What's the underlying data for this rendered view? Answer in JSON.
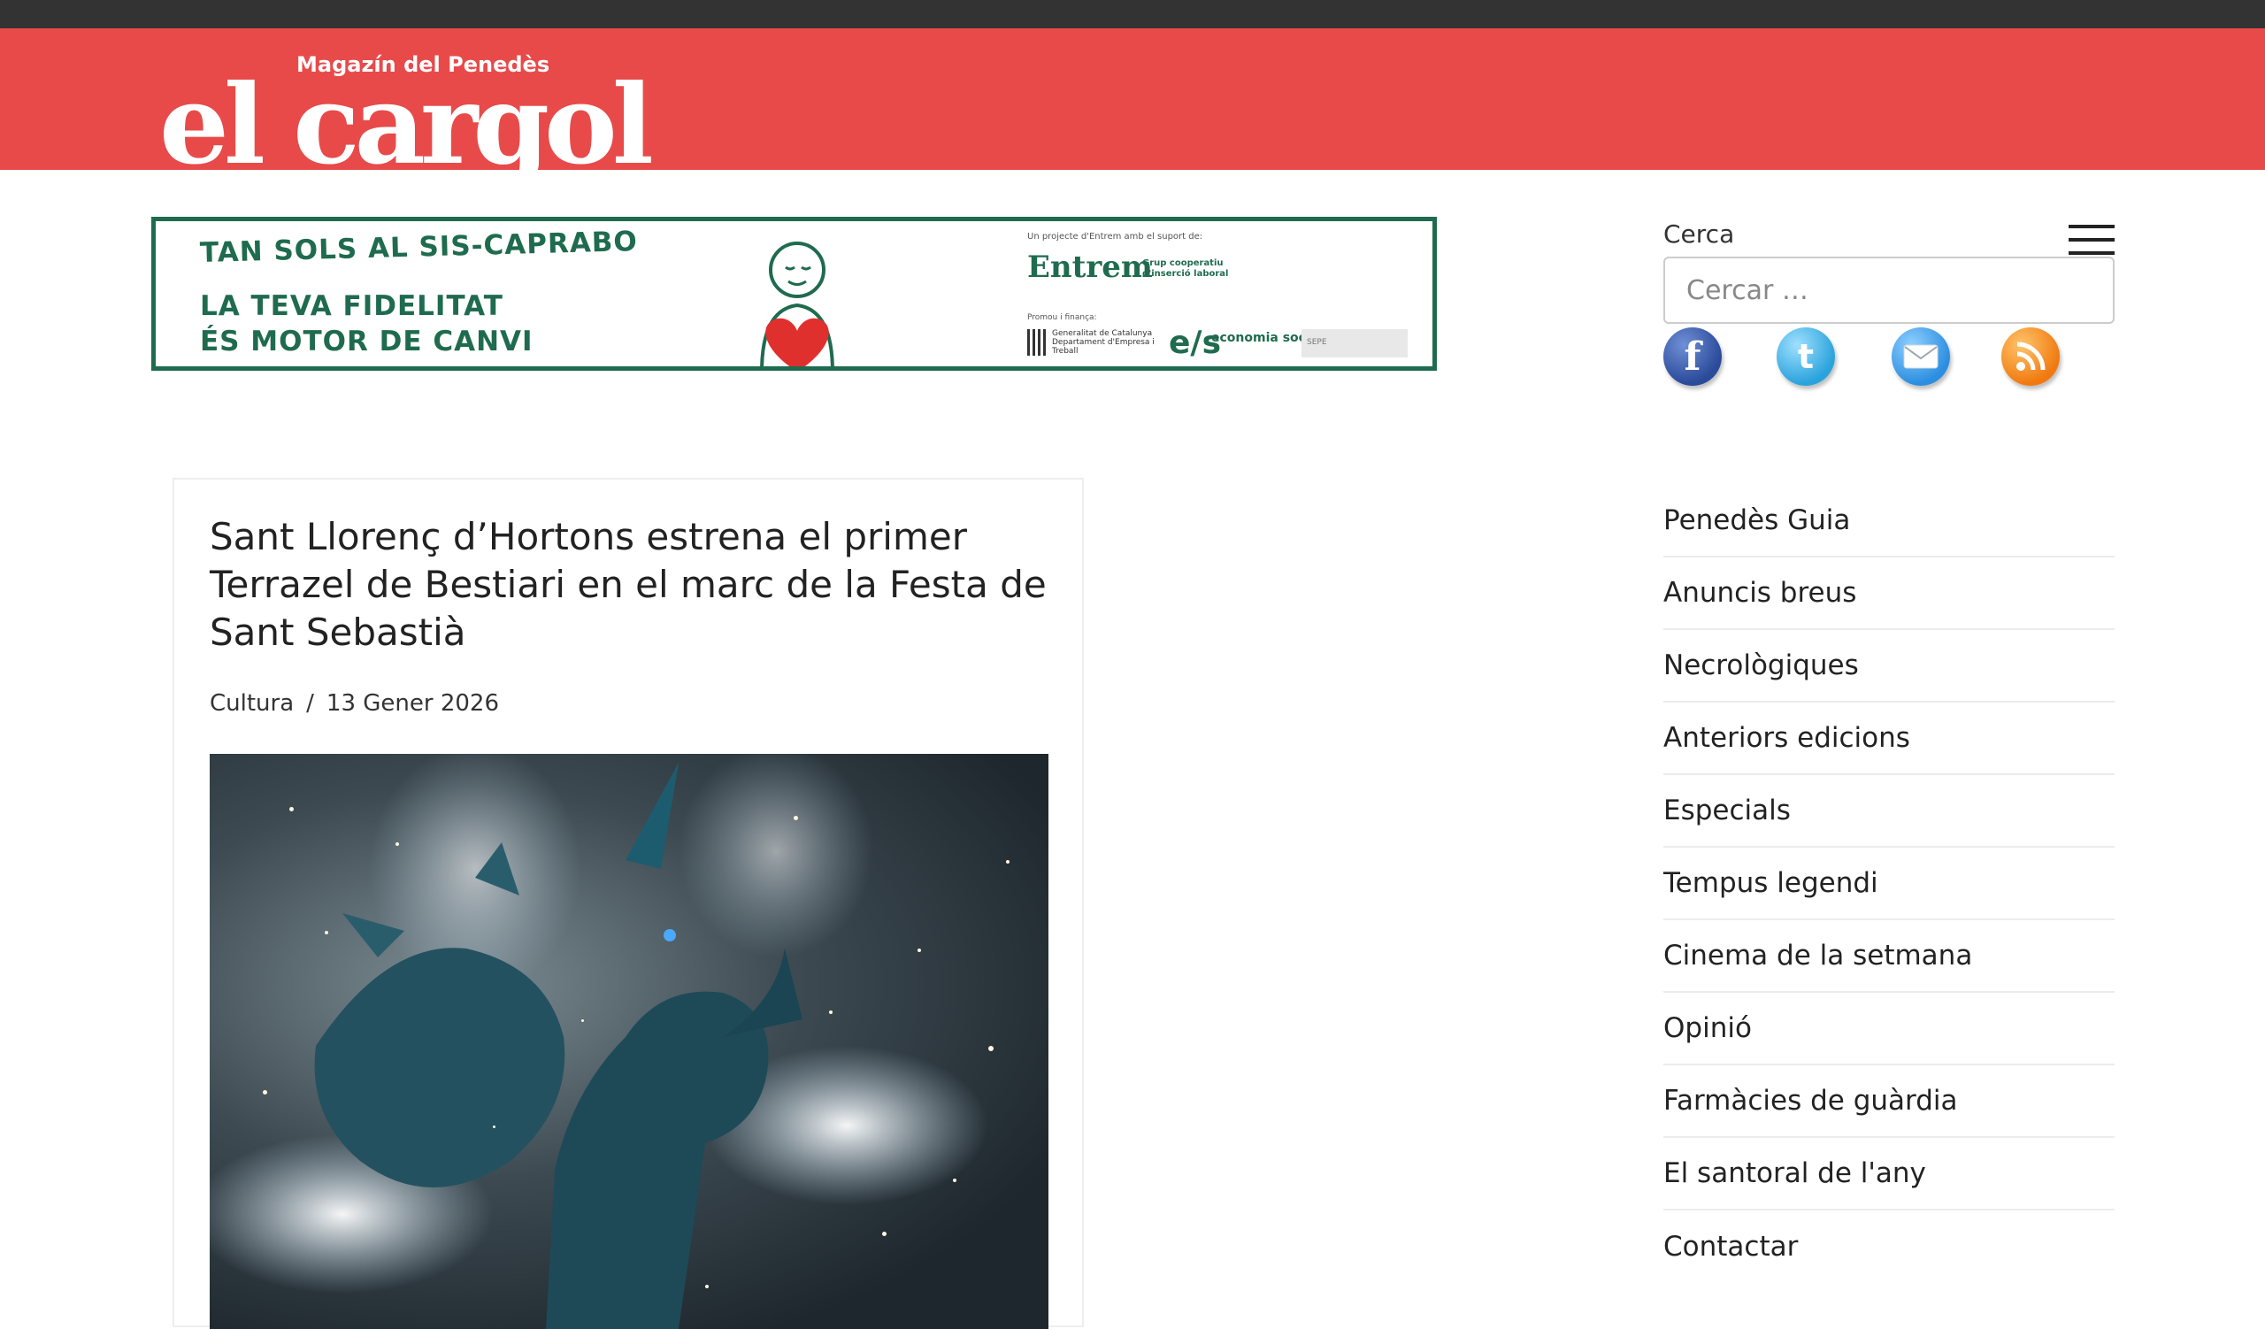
{
  "header": {
    "logo_tagline": "Magazín del Penedès",
    "logo_name": "el cargol",
    "brand_color": "#e84a4a"
  },
  "banner": {
    "line1": "TAN SOLS AL SIS-CAPRABO",
    "line2": "LA TEVA FIDELITAT",
    "line3": "ÉS MOTOR DE CANVI",
    "org_small": "Un projecte d'Entrem amb el suport de:",
    "entrem": "Entrem",
    "entrem_sub": "Grup cooperatiu d'inserció laboral",
    "promou": "Promou i finança:",
    "generalitat": "Generalitat de Catalunya Departament d'Empresa i Treball",
    "es_mark": "e/s",
    "economia": "economia social",
    "sepe": "SEPE",
    "accent_color": "#1f6b4f"
  },
  "sidebar": {
    "search_label": "Cerca",
    "search_placeholder": "Cercar …",
    "social": [
      {
        "name": "facebook-icon",
        "glyph": "f"
      },
      {
        "name": "twitter-icon",
        "glyph": "t"
      },
      {
        "name": "email-icon",
        "glyph": ""
      },
      {
        "name": "rss-icon",
        "glyph": ""
      }
    ],
    "nav_items": [
      "Penedès Guia",
      "Anuncis breus",
      "Necrològiques",
      "Anteriors edicions",
      "Especials",
      "Tempus legendi",
      "Cinema de la setmana",
      "Opinió",
      "Farmàcies de guàrdia",
      "El santoral de l'any",
      "Contactar"
    ]
  },
  "article": {
    "title": "Sant Llorenç d’Hortons estrena el primer Terrazel de Bestiari en el marc de la Festa de Sant Sebastià",
    "category": "Cultura",
    "separator": "/",
    "date": "13 Gener 2026"
  }
}
